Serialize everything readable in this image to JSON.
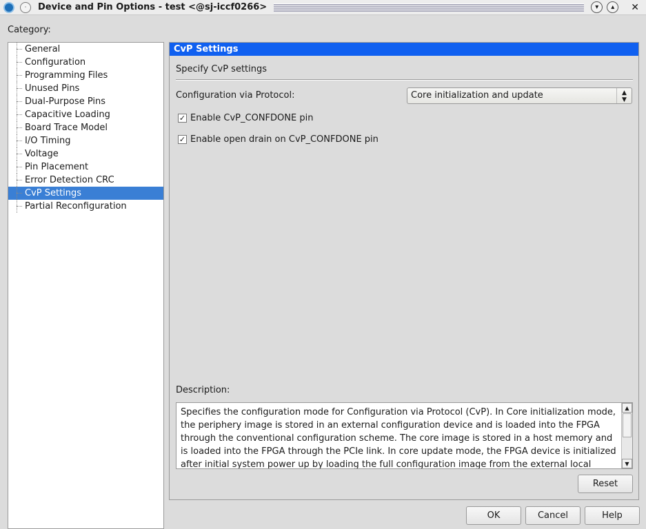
{
  "window": {
    "title": "Device and Pin Options - test <@sj-iccf0266>"
  },
  "category_label": "Category:",
  "categories": [
    "General",
    "Configuration",
    "Programming Files",
    "Unused Pins",
    "Dual-Purpose Pins",
    "Capacitive Loading",
    "Board Trace Model",
    "I/O Timing",
    "Voltage",
    "Pin Placement",
    "Error Detection CRC",
    "CvP Settings",
    "Partial Reconfiguration"
  ],
  "selected_category": "CvP Settings",
  "panel": {
    "title": "CvP Settings",
    "subtitle": "Specify CvP settings",
    "protocol_label": "Configuration via Protocol:",
    "protocol_value": "Core initialization and update",
    "checkboxes": [
      {
        "label": "Enable CvP_CONFDONE pin",
        "checked": true
      },
      {
        "label": "Enable open drain on CvP_CONFDONE pin",
        "checked": true
      }
    ],
    "description_label": "Description:",
    "description": "Specifies the configuration mode for Configuration via Protocol (CvP). In Core initialization mode, the periphery image is stored in an external configuration device and is loaded into the FPGA through the conventional configuration scheme. The core image is stored in a host memory and is loaded into the FPGA through the PCIe link. In core update mode, the FPGA device is initialized after initial system power up by loading the full configuration image from the external local configuration device to the",
    "reset_label": "Reset"
  },
  "buttons": {
    "ok": "OK",
    "cancel": "Cancel",
    "help": "Help"
  }
}
